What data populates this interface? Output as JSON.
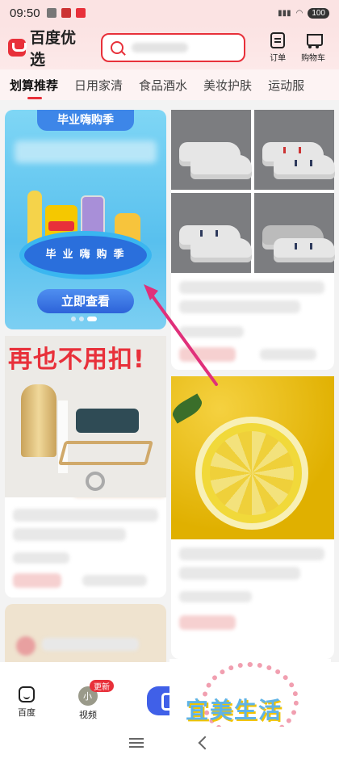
{
  "status": {
    "time": "09:50",
    "battery": "100"
  },
  "header": {
    "logo_text": "百度优选",
    "order_label": "订单",
    "cart_label": "购物车"
  },
  "tabs": [
    {
      "label": "划算推荐"
    },
    {
      "label": "日用家清"
    },
    {
      "label": "食品酒水"
    },
    {
      "label": "美妆护肤"
    },
    {
      "label": "运动服"
    }
  ],
  "banner": {
    "title": "毕业嗨购季",
    "ring_text": "毕业嗨购季",
    "cta": "立即查看",
    "chips_brand": "Lay's"
  },
  "promo": {
    "title": "再也不用扣!"
  },
  "bottom_nav": {
    "home_label": "百度",
    "video_label": "视频",
    "video_badge": "更新",
    "video_avatar_text": "小"
  },
  "watermark": {
    "text": "宜美生活"
  },
  "colors": {
    "accent": "#e8303a",
    "cta_blue": "#2d63d9",
    "banner_bg": "#58c0ee"
  }
}
